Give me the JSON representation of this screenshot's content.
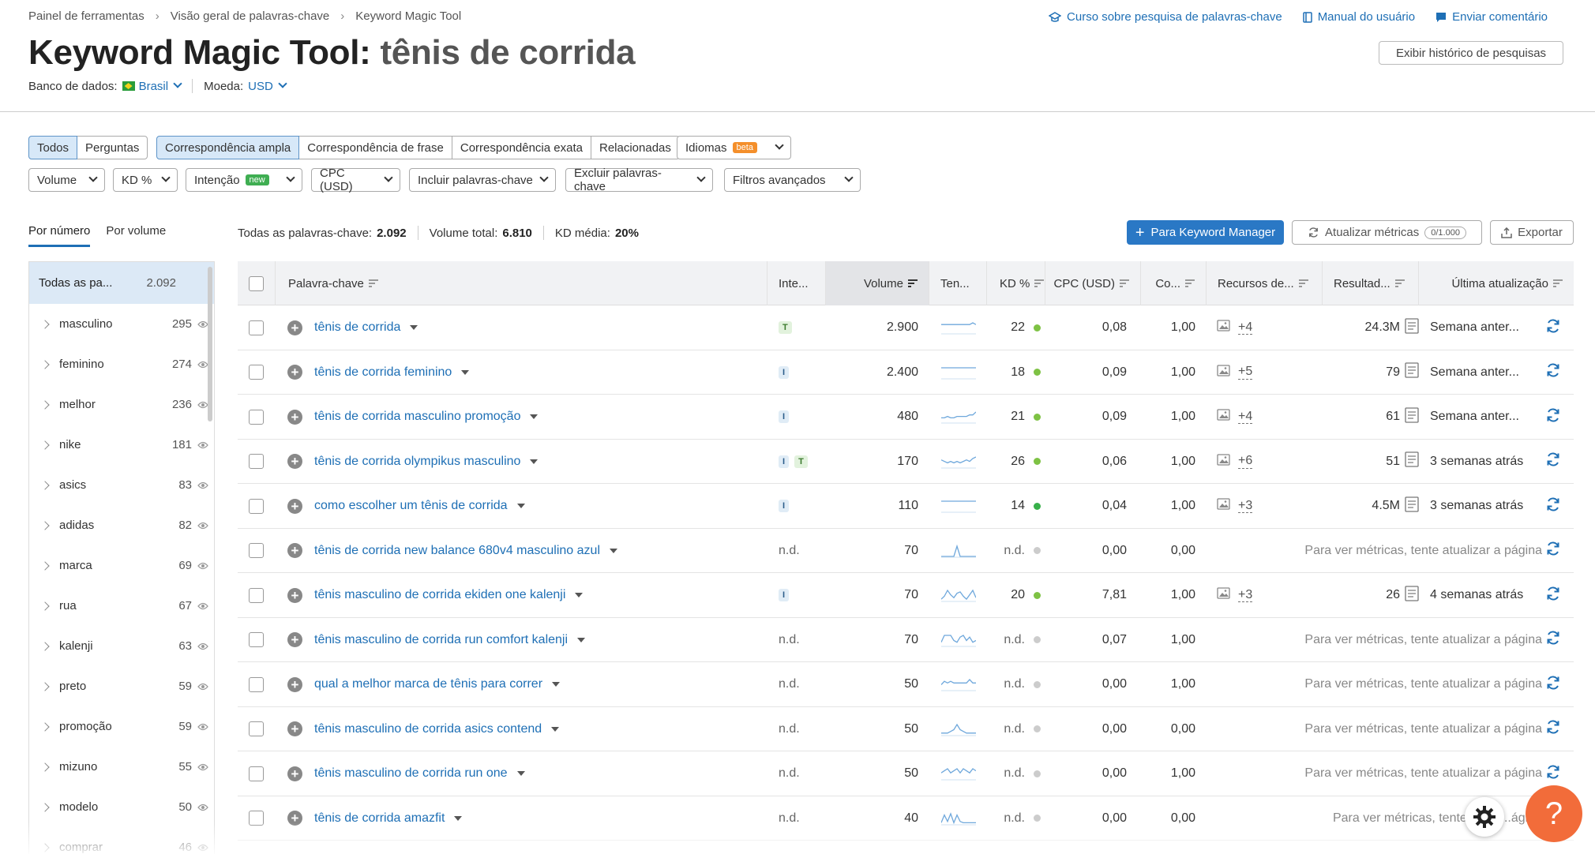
{
  "breadcrumb": [
    "Painel de ferramentas",
    "Visão geral de palavras-chave",
    "Keyword Magic Tool"
  ],
  "top_links": [
    "Curso sobre pesquisa de palavras-chave",
    "Manual do usuário",
    "Enviar comentário"
  ],
  "title": {
    "tool": "Keyword Magic Tool:",
    "query": "tênis de corrida"
  },
  "history_button": "Exibir histórico de pesquisas",
  "database": {
    "label": "Banco de dados:",
    "value": "Brasil",
    "currency_label": "Moeda:",
    "currency_value": "USD"
  },
  "tabs_type": [
    "Todos",
    "Perguntas"
  ],
  "tabs_match": [
    "Correspondência ampla",
    "Correspondência de frase",
    "Correspondência exata",
    "Relacionadas"
  ],
  "languages": {
    "label": "Idiomas",
    "badge": "beta"
  },
  "filters": {
    "volume": "Volume",
    "kd": "KD %",
    "intent": "Intenção",
    "intent_badge": "new",
    "cpc": "CPC (USD)",
    "include": "Incluir palavras-chave",
    "exclude": "Excluir palavras-chave",
    "advanced": "Filtros avançados"
  },
  "view_tabs": [
    "Por número",
    "Por volume"
  ],
  "stats": {
    "all_label": "Todas as palavras-chave:",
    "all_value": "2.092",
    "vol_label": "Volume total:",
    "vol_value": "6.810",
    "kd_label": "KD média:",
    "kd_value": "20%"
  },
  "actions": {
    "manager": "Para Keyword Manager",
    "update": "Atualizar métricas",
    "update_count": "0/1.000",
    "export": "Exportar"
  },
  "sidebar": {
    "all_label": "Todas as pa...",
    "all_count": "2.092",
    "items": [
      {
        "label": "masculino",
        "count": "295"
      },
      {
        "label": "feminino",
        "count": "274"
      },
      {
        "label": "melhor",
        "count": "236"
      },
      {
        "label": "nike",
        "count": "181"
      },
      {
        "label": "asics",
        "count": "83"
      },
      {
        "label": "adidas",
        "count": "82"
      },
      {
        "label": "marca",
        "count": "69"
      },
      {
        "label": "rua",
        "count": "67"
      },
      {
        "label": "kalenji",
        "count": "63"
      },
      {
        "label": "preto",
        "count": "59"
      },
      {
        "label": "promoção",
        "count": "59"
      },
      {
        "label": "mizuno",
        "count": "55"
      },
      {
        "label": "modelo",
        "count": "50"
      },
      {
        "label": "comprar",
        "count": "46"
      }
    ]
  },
  "columns": {
    "keyword": "Palavra-chave",
    "intent": "Inte...",
    "volume": "Volume",
    "trend": "Ten...",
    "kd": "KD %",
    "cpc": "CPC (USD)",
    "com": "Co...",
    "features": "Recursos de...",
    "results": "Resultad...",
    "updated": "Última atualização"
  },
  "colors": {
    "accent": "#1e6fb5",
    "kd_easy": "#7ec244",
    "kd_very_easy": "#38b04a",
    "help": "#f26c3a"
  },
  "rows": [
    {
      "kw": "tênis de corrida",
      "intent": [
        "T"
      ],
      "volume": "2.900",
      "kd": "22",
      "kd_color": "green",
      "cpc": "0,08",
      "com": "1,00",
      "feat": "+4",
      "results": "24.3M",
      "updated": "Semana anter...",
      "trend": [
        5,
        5,
        5,
        5,
        5,
        5,
        5,
        5,
        5,
        5,
        6,
        5
      ]
    },
    {
      "kw": "tênis de corrida feminino",
      "intent": [
        "I"
      ],
      "volume": "2.400",
      "kd": "18",
      "kd_color": "green",
      "cpc": "0,09",
      "com": "1,00",
      "feat": "+5",
      "results": "79",
      "updated": "Semana anter...",
      "trend": [
        5,
        5,
        5,
        5,
        5,
        5,
        5,
        5,
        5,
        5,
        5,
        5
      ]
    },
    {
      "kw": "tênis de corrida masculino promoção",
      "intent": [
        "I"
      ],
      "volume": "480",
      "kd": "21",
      "kd_color": "green",
      "cpc": "0,09",
      "com": "1,00",
      "feat": "+4",
      "results": "61",
      "updated": "Semana anter...",
      "trend": [
        3,
        3,
        4,
        3,
        3,
        4,
        4,
        4,
        4,
        5,
        5,
        7
      ]
    },
    {
      "kw": "tênis de corrida olympikus masculino",
      "intent": [
        "I",
        "T"
      ],
      "volume": "170",
      "kd": "26",
      "kd_color": "green",
      "cpc": "0,06",
      "com": "1,00",
      "feat": "+6",
      "results": "51",
      "updated": "3 semanas atrás",
      "trend": [
        5,
        4,
        3,
        4,
        3,
        4,
        3,
        4,
        5,
        4,
        6,
        7
      ]
    },
    {
      "kw": "como escolher um tênis de corrida",
      "intent": [
        "I"
      ],
      "volume": "110",
      "kd": "14",
      "kd_color": "green2",
      "cpc": "0,04",
      "com": "1,00",
      "feat": "+3",
      "results": "4.5M",
      "updated": "3 semanas atrás",
      "trend": [
        5,
        5,
        5,
        5,
        5,
        5,
        5,
        5,
        5,
        5,
        5,
        5
      ]
    },
    {
      "kw": "tênis de corrida new balance 680v4 masculino azul",
      "intent": [],
      "intent_text": "n.d.",
      "volume": "70",
      "kd": "n.d.",
      "kd_color": "gray",
      "cpc": "0,00",
      "com": "0,00",
      "feat": "",
      "results": "",
      "updated": "Para ver métricas, tente atualizar a página",
      "trend": [
        0,
        0,
        0,
        0,
        0,
        8,
        0,
        0,
        0,
        0,
        0,
        0
      ]
    },
    {
      "kw": "tênis masculino de corrida ekiden one kalenji",
      "intent": [
        "I"
      ],
      "volume": "70",
      "kd": "20",
      "kd_color": "green",
      "cpc": "7,81",
      "com": "1,00",
      "feat": "+3",
      "results": "26",
      "updated": "4 semanas atrás",
      "trend": [
        1,
        3,
        7,
        4,
        2,
        5,
        6,
        3,
        1,
        4,
        7,
        2
      ]
    },
    {
      "kw": "tênis masculino de corrida run comfort kalenji",
      "intent": [],
      "intent_text": "n.d.",
      "volume": "70",
      "kd": "n.d.",
      "kd_color": "gray",
      "cpc": "0,07",
      "com": "1,00",
      "feat": "",
      "results": "",
      "updated": "Para ver métricas, tente atualizar a página",
      "trend": [
        2,
        6,
        6,
        6,
        3,
        2,
        5,
        6,
        3,
        5,
        2,
        3
      ]
    },
    {
      "kw": "qual a melhor marca de tênis para correr",
      "intent": [],
      "intent_text": "n.d.",
      "volume": "50",
      "kd": "n.d.",
      "kd_color": "gray",
      "cpc": "0,00",
      "com": "1,00",
      "feat": "",
      "results": "",
      "updated": "Para ver métricas, tente atualizar a página",
      "trend": [
        3,
        5,
        4,
        5,
        4,
        4,
        4,
        4,
        4,
        6,
        4,
        4
      ]
    },
    {
      "kw": "tênis masculino de corrida asics contend",
      "intent": [],
      "intent_text": "n.d.",
      "volume": "50",
      "kd": "n.d.",
      "kd_color": "gray",
      "cpc": "0,00",
      "com": "0,00",
      "feat": "",
      "results": "",
      "updated": "Para ver métricas, tente atualizar a página",
      "trend": [
        1,
        1,
        1,
        2,
        3,
        6,
        3,
        2,
        1,
        1,
        1,
        1
      ]
    },
    {
      "kw": "tênis masculino de corrida run one",
      "intent": [],
      "intent_text": "n.d.",
      "volume": "50",
      "kd": "n.d.",
      "kd_color": "gray",
      "cpc": "0,00",
      "com": "1,00",
      "feat": "",
      "results": "",
      "updated": "Para ver métricas, tente atualizar a página",
      "trend": [
        3,
        4,
        5,
        3,
        4,
        5,
        3,
        5,
        4,
        3,
        5,
        4
      ]
    },
    {
      "kw": "tênis de corrida amazfit",
      "intent": [],
      "intent_text": "n.d.",
      "volume": "40",
      "kd": "n.d.",
      "kd_color": "gray",
      "cpc": "0,00",
      "com": "0,00",
      "feat": "",
      "results": "",
      "updated": "Para ver métricas, tente atuali...ágina",
      "trend": [
        1,
        7,
        2,
        8,
        1,
        7,
        2,
        1,
        1,
        1,
        1,
        1
      ]
    }
  ]
}
